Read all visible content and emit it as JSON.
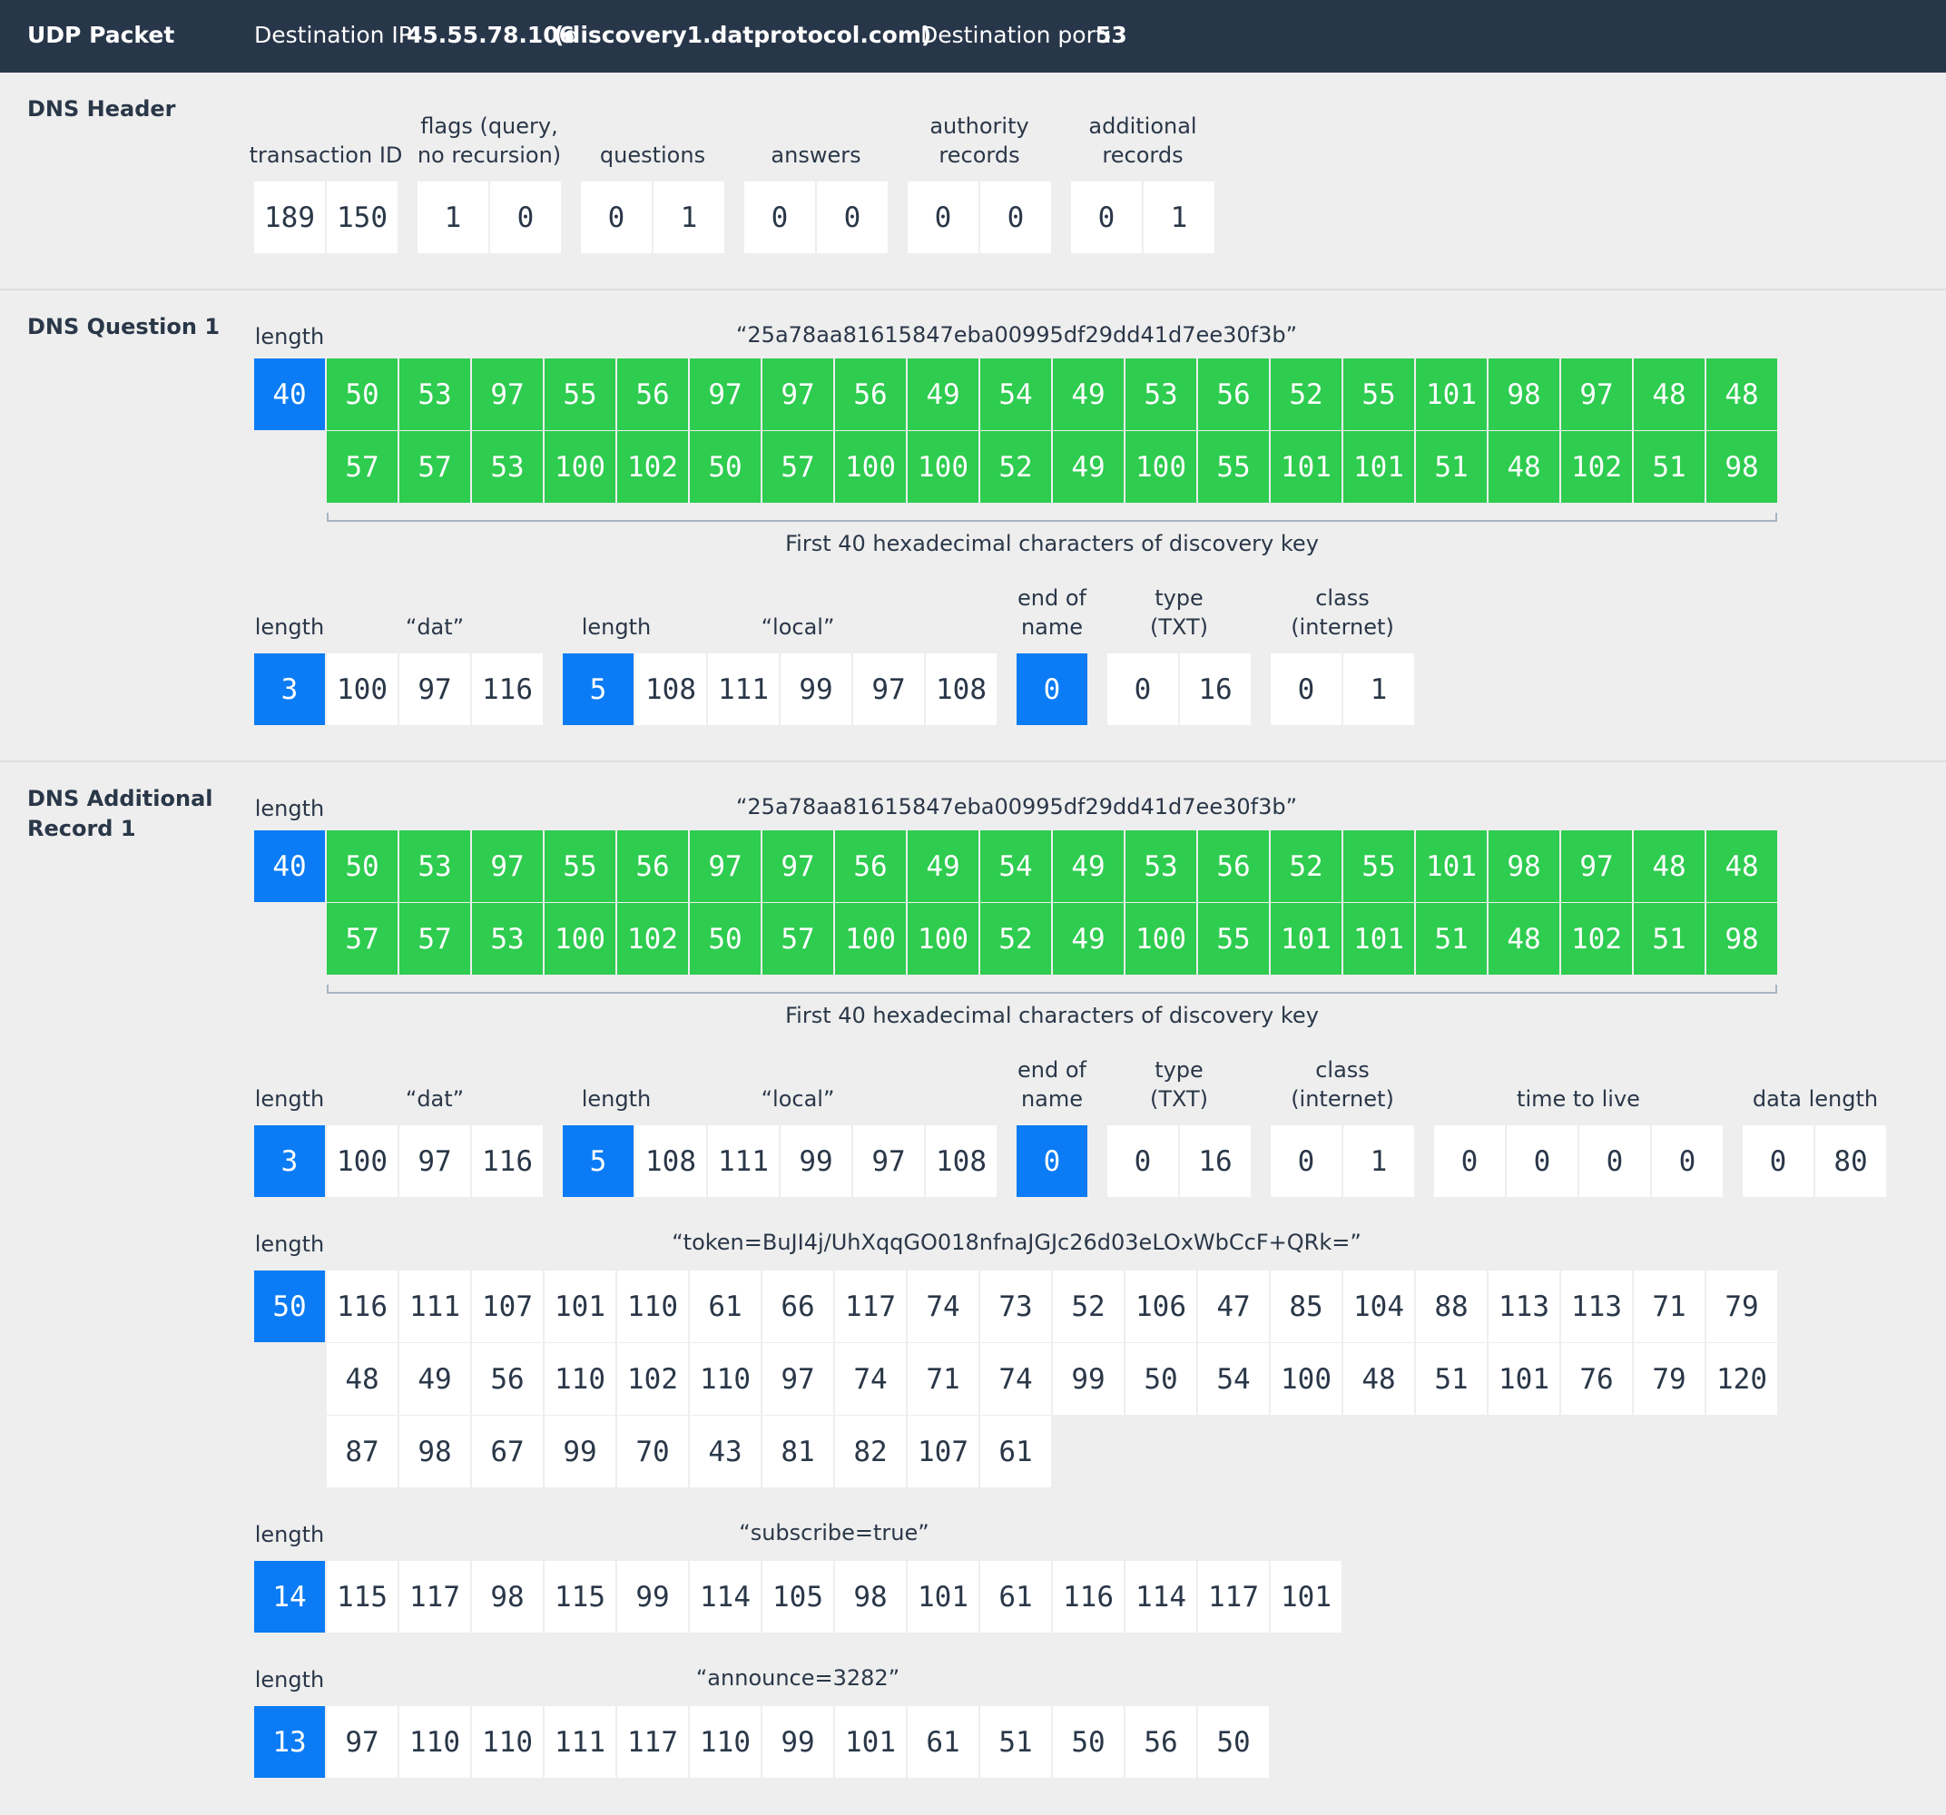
{
  "packet": {
    "title": "UDP Packet",
    "dest_ip_label": "Destination IP:",
    "dest_ip_value": "45.55.78.106",
    "dest_host": "(discovery1.datprotocol.com)",
    "dest_port_label": "Destination port:",
    "dest_port_value": "53"
  },
  "header": {
    "title": "DNS Header",
    "labels": [
      "transaction ID",
      "flags (query,\nno recursion)",
      "questions",
      "answers",
      "authority\nrecords",
      "additional\nrecords"
    ],
    "values": [
      [
        "189",
        "150"
      ],
      [
        "1",
        "0"
      ],
      [
        "0",
        "1"
      ],
      [
        "0",
        "0"
      ],
      [
        "0",
        "0"
      ],
      [
        "0",
        "1"
      ]
    ]
  },
  "question": {
    "title": "DNS Question 1",
    "length_label": "length",
    "key_string": "“25a78aa81615847eba00995df29dd41d7ee30f3b”",
    "key_length": "40",
    "key_row1": [
      "50",
      "53",
      "97",
      "55",
      "56",
      "97",
      "97",
      "56",
      "49",
      "54",
      "49",
      "53",
      "56",
      "52",
      "55",
      "101",
      "98",
      "97",
      "48",
      "48"
    ],
    "key_row2": [
      "57",
      "57",
      "53",
      "100",
      "102",
      "50",
      "57",
      "100",
      "100",
      "52",
      "49",
      "100",
      "55",
      "101",
      "101",
      "51",
      "48",
      "102",
      "51",
      "98"
    ],
    "key_caption": "First 40 hexadecimal characters of discovery key",
    "labels": {
      "length1": "length",
      "dat": "“dat”",
      "length2": "length",
      "local": "“local”",
      "end": "end of\nname",
      "type": "type\n(TXT)",
      "class": "class\n(internet)"
    },
    "dat_len": "3",
    "dat": [
      "100",
      "97",
      "116"
    ],
    "local_len": "5",
    "local": [
      "108",
      "111",
      "99",
      "97",
      "108"
    ],
    "end": "0",
    "type": [
      "0",
      "16"
    ],
    "class": [
      "0",
      "1"
    ]
  },
  "additional": {
    "title": "DNS Additional\nRecord 1",
    "length_label": "length",
    "key_string": "“25a78aa81615847eba00995df29dd41d7ee30f3b”",
    "key_length": "40",
    "key_row1": [
      "50",
      "53",
      "97",
      "55",
      "56",
      "97",
      "97",
      "56",
      "49",
      "54",
      "49",
      "53",
      "56",
      "52",
      "55",
      "101",
      "98",
      "97",
      "48",
      "48"
    ],
    "key_row2": [
      "57",
      "57",
      "53",
      "100",
      "102",
      "50",
      "57",
      "100",
      "100",
      "52",
      "49",
      "100",
      "55",
      "101",
      "101",
      "51",
      "48",
      "102",
      "51",
      "98"
    ],
    "key_caption": "First 40 hexadecimal characters of discovery key",
    "labels": {
      "length1": "length",
      "dat": "“dat”",
      "length2": "length",
      "local": "“local”",
      "end": "end of\nname",
      "type": "type\n(TXT)",
      "class": "class\n(internet)",
      "ttl": "time to live",
      "dlen": "data length"
    },
    "dat_len": "3",
    "dat": [
      "100",
      "97",
      "116"
    ],
    "local_len": "5",
    "local": [
      "108",
      "111",
      "99",
      "97",
      "108"
    ],
    "end": "0",
    "type": [
      "0",
      "16"
    ],
    "class": [
      "0",
      "1"
    ],
    "ttl": [
      "0",
      "0",
      "0",
      "0"
    ],
    "dlen": [
      "0",
      "80"
    ],
    "token": {
      "label": "length",
      "string": "“token=BuJI4j/UhXqqGO018nfnaJGJc26d03eLOxWbCcF+QRk=”",
      "length": "50",
      "row1": [
        "116",
        "111",
        "107",
        "101",
        "110",
        "61",
        "66",
        "117",
        "74",
        "73",
        "52",
        "106",
        "47",
        "85",
        "104",
        "88",
        "113",
        "113",
        "71",
        "79"
      ],
      "row2": [
        "48",
        "49",
        "56",
        "110",
        "102",
        "110",
        "97",
        "74",
        "71",
        "74",
        "99",
        "50",
        "54",
        "100",
        "48",
        "51",
        "101",
        "76",
        "79",
        "120"
      ],
      "row3": [
        "87",
        "98",
        "67",
        "99",
        "70",
        "43",
        "81",
        "82",
        "107",
        "61"
      ]
    },
    "subscribe": {
      "label": "length",
      "string": "“subscribe=true”",
      "length": "14",
      "values": [
        "115",
        "117",
        "98",
        "115",
        "99",
        "114",
        "105",
        "98",
        "101",
        "61",
        "116",
        "114",
        "117",
        "101"
      ]
    },
    "announce": {
      "label": "length",
      "string": "“announce=3282”",
      "length": "13",
      "values": [
        "97",
        "110",
        "110",
        "111",
        "117",
        "110",
        "99",
        "101",
        "61",
        "51",
        "50",
        "56",
        "50"
      ]
    }
  },
  "colors": {
    "blue": "#0b7cf5",
    "green": "#2ecc4f",
    "header_bg": "#28364a",
    "page_bg": "#eeeeee"
  }
}
